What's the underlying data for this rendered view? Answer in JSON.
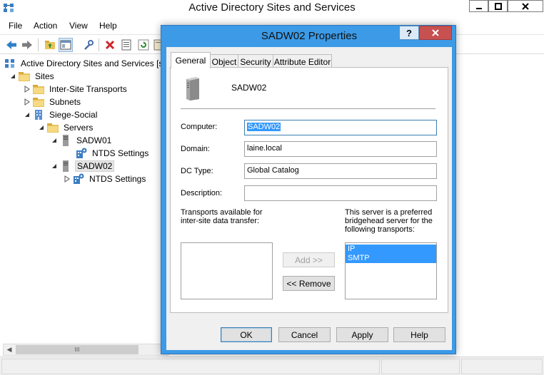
{
  "window": {
    "title": "Active Directory Sites and Services",
    "min_glyph": "–",
    "max_glyph": "◻",
    "close_glyph": "✕"
  },
  "menu": [
    "File",
    "Action",
    "View",
    "Help"
  ],
  "toolbar": {
    "icons": [
      "back-arrow-icon",
      "forward-arrow-icon",
      "folder-up-icon",
      "show-hide-console-tree-icon",
      "properties-wrench-icon",
      "delete-icon",
      "export-list-icon",
      "refresh-icon",
      "help-book-icon"
    ]
  },
  "tree": {
    "items": [
      {
        "label": "Active Directory Sites and Services [sa",
        "icon": "ad-sites-icon",
        "twisty": ""
      },
      {
        "label": "Sites",
        "icon": "folder-icon",
        "twisty": "expanded"
      },
      {
        "label": "Inter-Site Transports",
        "icon": "folder-icon",
        "twisty": "collapsed"
      },
      {
        "label": "Subnets",
        "icon": "folder-icon",
        "twisty": "collapsed"
      },
      {
        "label": "Siege-Social",
        "icon": "site-icon",
        "twisty": "expanded"
      },
      {
        "label": "Servers",
        "icon": "folder-icon",
        "twisty": "expanded"
      },
      {
        "label": "SADW01",
        "icon": "server-icon",
        "twisty": "expanded"
      },
      {
        "label": "NTDS Settings",
        "icon": "ntds-settings-icon",
        "twisty": ""
      },
      {
        "label": "SADW02",
        "icon": "server-icon",
        "twisty": "expanded",
        "selected": true
      },
      {
        "label": "NTDS Settings",
        "icon": "ntds-settings-icon",
        "twisty": "collapsed"
      }
    ],
    "hscroll_thumb_glyph": "III"
  },
  "dialog": {
    "title": "SADW02 Properties",
    "help_glyph": "?",
    "close_glyph": "✕",
    "tabs": [
      {
        "label": "General",
        "active": true
      },
      {
        "label": "Object"
      },
      {
        "label": "Security"
      },
      {
        "label": "Attribute Editor"
      }
    ],
    "header_name": "SADW02",
    "computer_label": "Computer:",
    "computer_value": "SADW02",
    "domain_label": "Domain:",
    "domain_value": "laine.local",
    "dctype_label": "DC Type:",
    "dctype_value": "Global Catalog",
    "description_label": "Description:",
    "description_value": "",
    "transports_available_label": "Transports available for inter-site data transfer:",
    "preferred_label": "This server is a preferred bridgehead server for the following transports:",
    "available_transports": [],
    "preferred_transports": [
      "IP",
      "SMTP"
    ],
    "add_button": "Add >>",
    "remove_button": "<< Remove",
    "ok_button": "OK",
    "cancel_button": "Cancel",
    "apply_button": "Apply",
    "help_button": "Help"
  }
}
